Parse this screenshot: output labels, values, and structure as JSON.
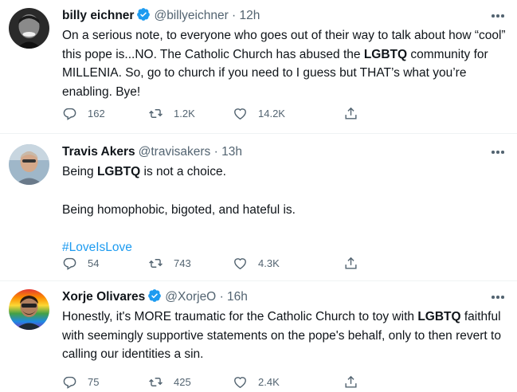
{
  "colors": {
    "link": "#1d9bf0",
    "verified": "#1d9bf0",
    "secondary": "#536471"
  },
  "tweets": [
    {
      "name": "billy eichner",
      "verified": true,
      "handle": "@billyeichner",
      "dot": "·",
      "time": "12h",
      "body_parts": [
        "On a serious note, to everyone who goes out of their way to talk about how “cool” this pope is...NO. The Catholic Church has abused the ",
        "LGBTQ",
        " community for MILLENIA. So, go to church if you need to I guess but THAT’s what you’re enabling. Bye!"
      ],
      "replies": "162",
      "retweets": "1.2K",
      "likes": "14.2K"
    },
    {
      "name": "Travis Akers",
      "verified": false,
      "handle": "@travisakers",
      "dot": "·",
      "time": "13h",
      "line1_a": "Being ",
      "line1_b": "LGBTQ",
      "line1_c": " is not a choice.",
      "line2": "Being homophobic, bigoted, and hateful is.",
      "hashtag": "#LoveIsLove",
      "replies": "54",
      "retweets": "743",
      "likes": "4.3K"
    },
    {
      "name": "Xorje Olivares",
      "verified": true,
      "handle": "@XorjeO",
      "dot": "·",
      "time": "16h",
      "body_parts": [
        "Honestly, it's MORE traumatic for the Catholic Church to toy with ",
        "LGBTQ",
        " faithful with seemingly supportive statements on the pope's behalf, only to then revert to calling our identities a sin."
      ],
      "replies": "75",
      "retweets": "425",
      "likes": "2.4K"
    }
  ]
}
